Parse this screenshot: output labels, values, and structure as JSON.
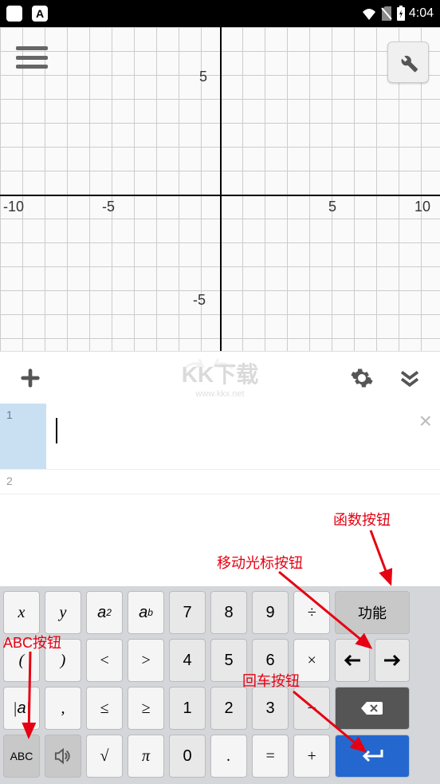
{
  "status_bar": {
    "time": "4:04",
    "icons": [
      "wifi",
      "no-sim",
      "battery-charging"
    ],
    "left_box1": "",
    "left_box2": "A"
  },
  "graph": {
    "x_ticks": [
      "-10",
      "-5",
      "5",
      "10"
    ],
    "y_ticks": [
      "5",
      "-5"
    ],
    "x_range": [
      -10,
      10
    ],
    "y_range": [
      -6,
      6
    ]
  },
  "watermark": {
    "logo": "KK下载",
    "url": "www.kkx.net"
  },
  "input_rows": [
    {
      "num": "1",
      "value": "",
      "active": true
    },
    {
      "num": "2",
      "value": "",
      "active": false
    }
  ],
  "annotations": {
    "function_btn": "函数按钮",
    "cursor_btn": "移动光标按钮",
    "abc_btn": "ABC按钮",
    "enter_btn": "回车按钮"
  },
  "keyboard": {
    "left": [
      [
        "x",
        "y",
        "a²",
        "aᵇ"
      ],
      [
        "(",
        ")",
        "<",
        ">"
      ],
      [
        "|a|",
        ",",
        "≤",
        "≥"
      ],
      [
        "ABC",
        "🔊",
        "√",
        "π"
      ]
    ],
    "mid": [
      [
        "7",
        "8",
        "9",
        "÷"
      ],
      [
        "4",
        "5",
        "6",
        "×"
      ],
      [
        "1",
        "2",
        "3",
        ""
      ],
      [
        "0",
        ".",
        "=",
        "+"
      ]
    ],
    "right": {
      "func": "功能",
      "left": "←",
      "right": "→",
      "back": "⌫",
      "enter": "↵"
    }
  }
}
